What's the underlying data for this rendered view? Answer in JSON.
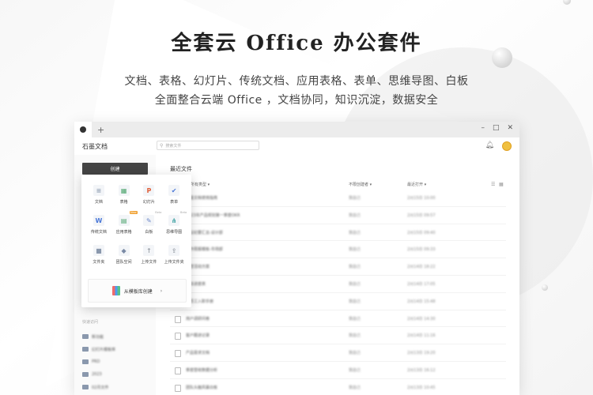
{
  "hero": {
    "title": "全套云 Office 办公套件",
    "subtitle_line1": "文档、表格、幻灯片、传统文档、应用表格、表单、思维导图、白板",
    "subtitle_line2": "全面整合云端 Office ，文档协同，知识沉淀，数据安全"
  },
  "window": {
    "tab_add": "+",
    "controls": {
      "minimize": "–",
      "maximize": "□",
      "close": "✕"
    },
    "brand": "石墨文档",
    "search_placeholder": "搜索文件",
    "create_label": "创建",
    "main_title": "最近文件",
    "columns": {
      "type": "所有类型",
      "creator": "不限创建者",
      "opened": "最近打开"
    },
    "quick_title": "快速访问",
    "quick_items": [
      "新功能",
      "幻灯片模板库",
      "PRD",
      "2023",
      "02月文件"
    ],
    "rows": [
      {
        "name": "石墨文档使用指南",
        "creator": "我自己",
        "time": "2月15日 10:00"
      },
      {
        "name": "2023年产品规划第一季度OKR",
        "creator": "我自己",
        "time": "2月15日 09:57"
      },
      {
        "name": "会议纪要汇总-设计部",
        "creator": "我自己",
        "time": "2月15日 09:40"
      },
      {
        "name": "工作周报模板-市场部",
        "creator": "我自己",
        "time": "2月15日 09:33"
      },
      {
        "name": "运营活动方案",
        "creator": "我自己",
        "time": "2月14日 18:22"
      },
      {
        "name": "项目进度表",
        "creator": "我自己",
        "time": "2月14日 17:05"
      },
      {
        "name": "新员工入职手册",
        "creator": "我自己",
        "time": "2月14日 15:48"
      },
      {
        "name": "用户调研问卷",
        "creator": "我自己",
        "time": "2月14日 14:30"
      },
      {
        "name": "客户跟进记录",
        "creator": "我自己",
        "time": "2月14日 11:16"
      },
      {
        "name": "产品需求文档",
        "creator": "我自己",
        "time": "2月13日 19:20"
      },
      {
        "name": "季度营收数据分析",
        "creator": "我自己",
        "time": "2月13日 16:12"
      },
      {
        "name": "团队头脑风暴白板",
        "creator": "我自己",
        "time": "2月13日 10:45"
      }
    ]
  },
  "popup": {
    "items": [
      {
        "label": "文档",
        "glyph": "≡",
        "color": "#9aa7b8"
      },
      {
        "label": "表格",
        "glyph": "▦",
        "color": "#4aa36a"
      },
      {
        "label": "幻灯片",
        "glyph": "P",
        "color": "#e0603a"
      },
      {
        "label": "表单",
        "glyph": "✔",
        "color": "#4a78d8"
      },
      {
        "label": "传统文档",
        "glyph": "W",
        "color": "#4a78d8"
      },
      {
        "label": "应用表格",
        "glyph": "▤",
        "color": "#4aa36a",
        "badge": "New"
      },
      {
        "label": "白板",
        "glyph": "✎",
        "color": "#6a86c8",
        "badge": "Beta"
      },
      {
        "label": "思维导图",
        "glyph": "⋔",
        "color": "#3aa0a0",
        "badge": "Beta"
      },
      {
        "label": "文件夹",
        "glyph": "■",
        "color": "#8a98ad"
      },
      {
        "label": "团队空间",
        "glyph": "◆",
        "color": "#7a8aa5"
      },
      {
        "label": "上传文件",
        "glyph": "↑",
        "color": "#9aa0a8"
      },
      {
        "label": "上传文件夹",
        "glyph": "⇪",
        "color": "#9aa0a8"
      }
    ],
    "template_label": "从模板库创建",
    "template_arrow": "›"
  }
}
